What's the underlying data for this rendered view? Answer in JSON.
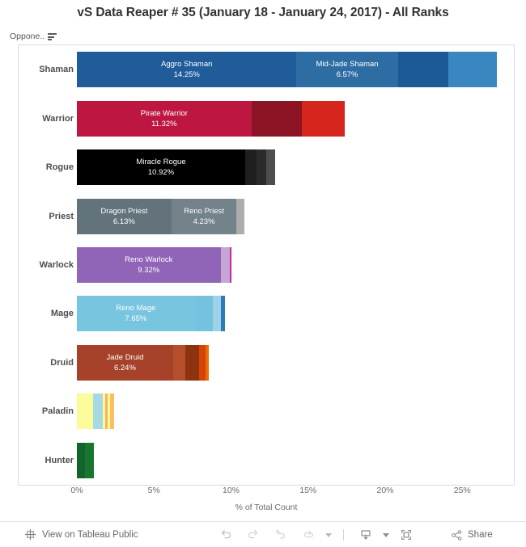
{
  "header": {
    "title": "vS Data Reaper # 35 (January 18 - January 24, 2017) - All Ranks"
  },
  "filter": {
    "label": "Oppone..",
    "icon": "filter-icon"
  },
  "axis": {
    "title": "% of Total Count",
    "ticks": [
      "0%",
      "5%",
      "10%",
      "15%",
      "20%",
      "25%"
    ],
    "tick_values": [
      0,
      5,
      10,
      15,
      20,
      25
    ],
    "min": 0,
    "max": 28
  },
  "toolbar": {
    "view_on_tableau_public": "View on Tableau Public",
    "share_label": "Share",
    "icons": [
      "tableau-logo-icon",
      "undo-icon",
      "redo-icon",
      "revert-icon",
      "refresh-icon",
      "refresh-dropdown-caret-icon",
      "download-icon",
      "download-dropdown-caret-icon",
      "fullscreen-icon",
      "share-icon"
    ]
  },
  "chart_data": {
    "type": "bar",
    "orientation": "horizontal",
    "stacked": true,
    "title": "vS Data Reaper # 35 (January 18 - January 24, 2017) - All Ranks",
    "xlabel": "% of Total Count",
    "ylabel": "",
    "xlim": [
      0,
      28
    ],
    "grid": false,
    "legend": "none",
    "categories": [
      "Shaman",
      "Warrior",
      "Rogue",
      "Priest",
      "Warlock",
      "Mage",
      "Druid",
      "Paladin",
      "Hunter"
    ],
    "rows": [
      {
        "category": "Shaman",
        "total": 27.25,
        "segments": [
          {
            "label": "Aggro Shaman",
            "value": 14.25,
            "value_text": "14.25%",
            "color": "#1f5c99",
            "show_label": true
          },
          {
            "label": "Mid-Jade Shaman",
            "value": 6.57,
            "value_text": "6.57%",
            "color": "#2e6da4",
            "show_label": true
          },
          {
            "label": "",
            "value": 3.25,
            "value_text": "",
            "color": "#1b5a96",
            "show_label": false
          },
          {
            "label": "",
            "value": 3.18,
            "value_text": "",
            "color": "#3a86c0",
            "show_label": false
          }
        ]
      },
      {
        "category": "Warrior",
        "total": 17.35,
        "segments": [
          {
            "label": "Pirate Warrior",
            "value": 11.32,
            "value_text": "11.32%",
            "color": "#bd1741",
            "show_label": true
          },
          {
            "label": "",
            "value": 3.25,
            "value_text": "",
            "color": "#8c1424",
            "show_label": false
          },
          {
            "label": "",
            "value": 2.78,
            "value_text": "",
            "color": "#d6251c",
            "show_label": false
          }
        ]
      },
      {
        "category": "Rogue",
        "total": 12.85,
        "segments": [
          {
            "label": "Miracle Rogue",
            "value": 10.92,
            "value_text": "10.92%",
            "color": "#000000",
            "show_label": true
          },
          {
            "label": "",
            "value": 0.72,
            "value_text": "",
            "color": "#1f1f1f",
            "show_label": false
          },
          {
            "label": "",
            "value": 0.62,
            "value_text": "",
            "color": "#2b2b2b",
            "show_label": false
          },
          {
            "label": "",
            "value": 0.59,
            "value_text": "",
            "color": "#4d4d4d",
            "show_label": false
          }
        ]
      },
      {
        "category": "Priest",
        "total": 10.85,
        "segments": [
          {
            "label": "Dragon Priest",
            "value": 6.13,
            "value_text": "6.13%",
            "color": "#62737c",
            "show_label": true
          },
          {
            "label": "Reno Priest",
            "value": 4.23,
            "value_text": "4.23%",
            "color": "#74828a",
            "show_label": true
          },
          {
            "label": "",
            "value": 0.49,
            "value_text": "",
            "color": "#adadad",
            "show_label": false
          }
        ]
      },
      {
        "category": "Warlock",
        "total": 10.05,
        "segments": [
          {
            "label": "Reno Warlock",
            "value": 9.32,
            "value_text": "9.32%",
            "color": "#9064b6",
            "show_label": true
          },
          {
            "label": "",
            "value": 0.58,
            "value_text": "",
            "color": "#c4a7d6",
            "show_label": false
          },
          {
            "label": "",
            "value": 0.15,
            "value_text": "",
            "color": "#cc2599",
            "show_label": false
          }
        ]
      },
      {
        "category": "Mage",
        "total": 9.8,
        "segments": [
          {
            "label": "Reno Mage",
            "value": 7.65,
            "value_text": "7.65%",
            "color": "#78c5e0",
            "show_label": true
          },
          {
            "label": "",
            "value": 1.15,
            "value_text": "",
            "color": "#74c2de",
            "show_label": false
          },
          {
            "label": "",
            "value": 0.52,
            "value_text": "",
            "color": "#9fd2e8",
            "show_label": false
          },
          {
            "label": "",
            "value": 0.3,
            "value_text": "",
            "color": "#2b7cb8",
            "show_label": false
          }
        ]
      },
      {
        "category": "Druid",
        "total": 8.55,
        "segments": [
          {
            "label": "Jade Druid",
            "value": 6.24,
            "value_text": "6.24%",
            "color": "#a7422a",
            "show_label": true
          },
          {
            "label": "",
            "value": 0.78,
            "value_text": "",
            "color": "#b54e2b",
            "show_label": false
          },
          {
            "label": "",
            "value": 0.93,
            "value_text": "",
            "color": "#8d3310",
            "show_label": false
          },
          {
            "label": "",
            "value": 0.4,
            "value_text": "",
            "color": "#d44406",
            "show_label": false
          },
          {
            "label": "",
            "value": 0.22,
            "value_text": "",
            "color": "#f06a07",
            "show_label": false
          }
        ]
      },
      {
        "category": "Paladin",
        "total": 2.4,
        "segments": [
          {
            "label": "",
            "value": 1.06,
            "value_text": "",
            "color": "#fbfb99",
            "show_label": false
          },
          {
            "label": "",
            "value": 0.6,
            "value_text": "",
            "color": "#a5d9e6",
            "show_label": false
          },
          {
            "label": "",
            "value": 0.16,
            "value_text": "",
            "color": "#fbfb99",
            "show_label": false
          },
          {
            "label": "",
            "value": 0.2,
            "value_text": "",
            "color": "#fbb264",
            "show_label": false
          },
          {
            "label": "",
            "value": 0.13,
            "value_text": "",
            "color": "#fbfb99",
            "show_label": false
          },
          {
            "label": "",
            "value": 0.25,
            "value_text": "",
            "color": "#fcbe60",
            "show_label": false
          }
        ]
      },
      {
        "category": "Hunter",
        "total": 1.12,
        "segments": [
          {
            "label": "",
            "value": 0.52,
            "value_text": "",
            "color": "#11652b",
            "show_label": false
          },
          {
            "label": "",
            "value": 0.6,
            "value_text": "",
            "color": "#19762f",
            "show_label": false
          }
        ]
      }
    ]
  }
}
